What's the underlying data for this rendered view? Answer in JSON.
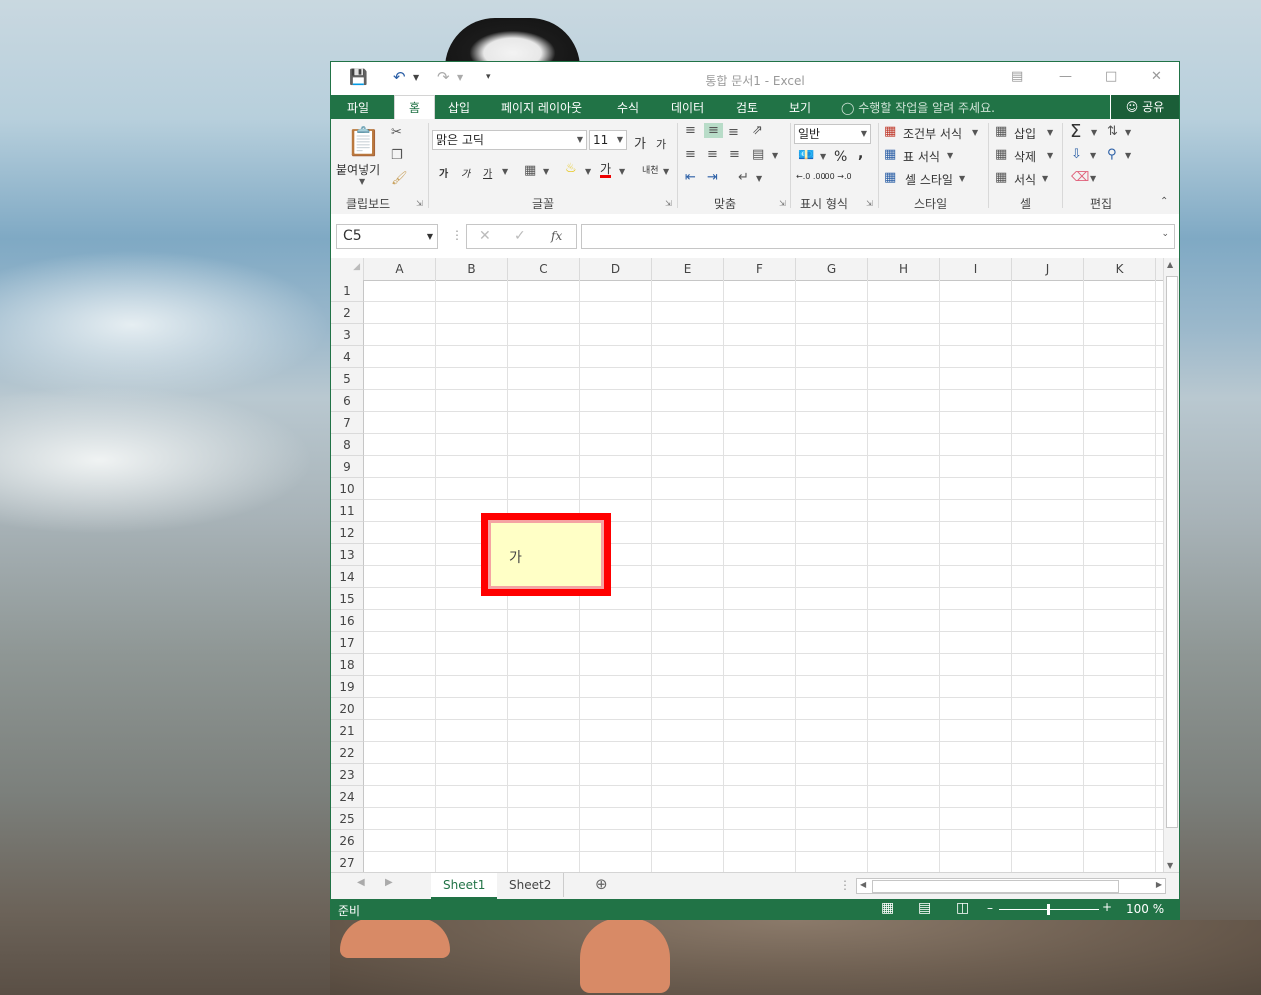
{
  "window": {
    "title": "통합 문서1 - Excel"
  },
  "tabs": [
    "파일",
    "홈",
    "삽입",
    "페이지 레이아웃",
    "수식",
    "데이터",
    "검토",
    "보기"
  ],
  "tell_me": "수행할 작업을 알려 주세요.",
  "share": "공유",
  "ribbon": {
    "clipboard": {
      "paste": "붙여넣기",
      "label": "클립보드"
    },
    "font": {
      "name": "맑은 고딕",
      "size": "11",
      "label": "글꼴",
      "bold": "가",
      "italic": "가",
      "underline": "가",
      "grow": "가",
      "shrink": "가",
      "color_letter": "가",
      "phonetic": "내천"
    },
    "alignment": {
      "label": "맞춤"
    },
    "number": {
      "format": "일반",
      "label": "표시 형식",
      "percent": "%",
      "comma": ",",
      "inc_decimal": "←.0 .00",
      "dec_decimal": ".00 →.0"
    },
    "styles": {
      "conditional": "조건부 서식",
      "table": "표 서식",
      "cell": "셀 스타일",
      "label": "스타일"
    },
    "cells": {
      "insert": "삽입",
      "delete": "삭제",
      "format": "서식",
      "label": "셀"
    },
    "editing": {
      "label": "편집",
      "sum": "Σ"
    }
  },
  "formula_bar": {
    "name_box": "C5",
    "fx": "fx",
    "value": ""
  },
  "columns": [
    "A",
    "B",
    "C",
    "D",
    "E",
    "F",
    "G",
    "H",
    "I",
    "J",
    "K"
  ],
  "rows": [
    "1",
    "2",
    "3",
    "4",
    "5",
    "6",
    "7",
    "8",
    "9",
    "10",
    "11",
    "12",
    "13",
    "14",
    "15",
    "16",
    "17",
    "18",
    "19",
    "20",
    "21",
    "22",
    "23",
    "24",
    "25",
    "26",
    "27"
  ],
  "comment": {
    "text": "가"
  },
  "sheets": [
    "Sheet1",
    "Sheet2"
  ],
  "active_sheet": "Sheet1",
  "status": {
    "ready": "준비",
    "zoom": "100 %"
  },
  "colors": {
    "accent": "#217346",
    "highlight": "#ff0000",
    "note_bg": "#ffffc6"
  }
}
